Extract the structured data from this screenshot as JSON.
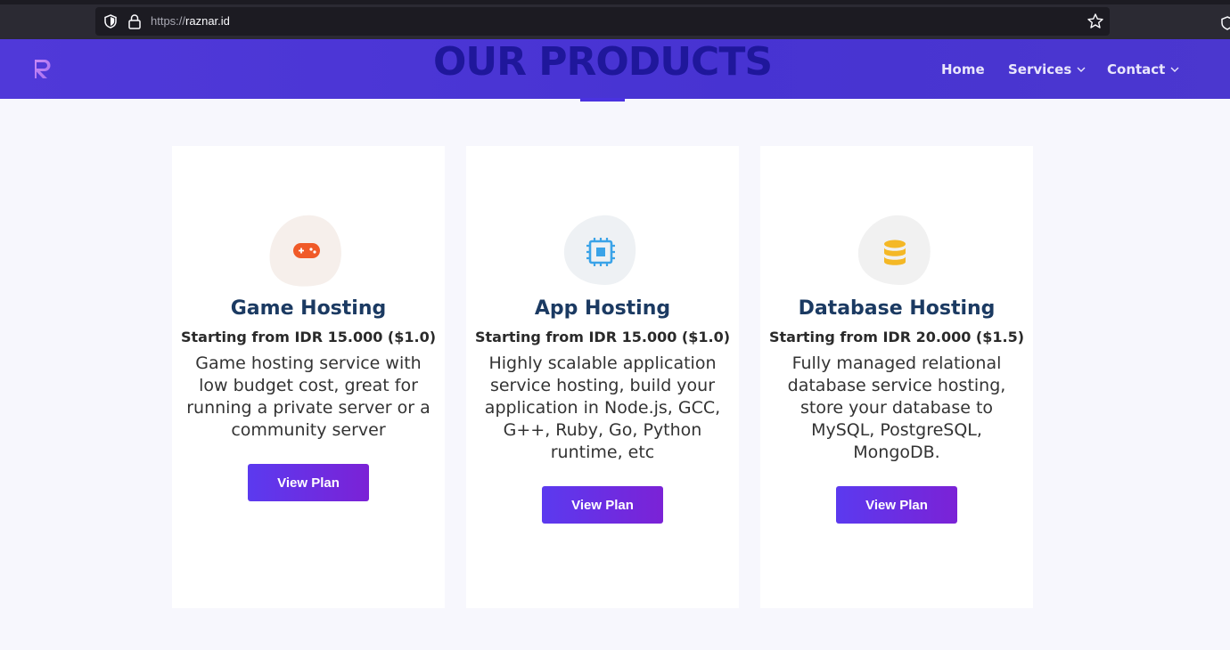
{
  "browser": {
    "url_protocol": "https://",
    "url_host": "raznar.id"
  },
  "header": {
    "logo_letter": "R",
    "nav": [
      {
        "label": "Home",
        "has_dropdown": false
      },
      {
        "label": "Services",
        "has_dropdown": true
      },
      {
        "label": "Contact",
        "has_dropdown": true
      }
    ]
  },
  "section": {
    "title": "OUR PRODUCTS"
  },
  "products": [
    {
      "icon": "gamepad-icon",
      "icon_color": "#f05a28",
      "title": "Game Hosting",
      "price": "Starting from IDR 15.000 ($1.0)",
      "description": "Game hosting service with low budget cost, great for running a private server or a community server",
      "button": "View Plan"
    },
    {
      "icon": "cpu-chip-icon",
      "icon_color": "#3aa3e8",
      "title": "App Hosting",
      "price": "Starting from IDR 15.000 ($1.0)",
      "description": "Highly scalable application service hosting, build your application in Node.js, GCC, G++, Ruby, Go, Python runtime, etc",
      "button": "View Plan"
    },
    {
      "icon": "database-icon",
      "icon_color": "#f4b826",
      "title": "Database Hosting",
      "price": "Starting from IDR 20.000 ($1.5)",
      "description": "Fully managed relational database service hosting, store your database to MySQL, PostgreSQL, MongoDB.",
      "button": "View Plan"
    }
  ],
  "colors": {
    "header_bg": "#4b37d6",
    "title_color": "#1f179b",
    "card_title": "#1b3a62",
    "button_start": "#5b3aef",
    "button_end": "#7b22d6"
  }
}
